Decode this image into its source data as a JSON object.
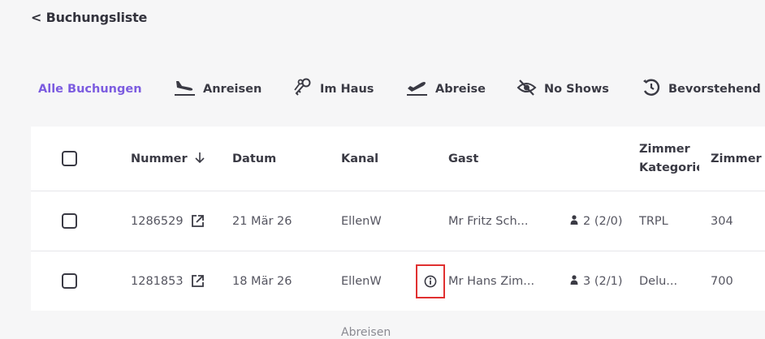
{
  "header": {
    "back_label": "< Buchungsliste"
  },
  "tabs": [
    {
      "label": "Alle Buchungen",
      "icon": "",
      "active": true
    },
    {
      "label": "Anreisen",
      "icon": "plane-landing-icon"
    },
    {
      "label": "Im Haus",
      "icon": "keys-icon"
    },
    {
      "label": "Abreise",
      "icon": "plane-departure-icon"
    },
    {
      "label": "No Shows",
      "icon": "eye-slash-icon"
    },
    {
      "label": "Bevorstehend",
      "icon": "clock-history-icon"
    }
  ],
  "table": {
    "columns": {
      "nummer": "Nummer",
      "datum": "Datum",
      "kanal": "Kanal",
      "gast": "Gast",
      "zimmer_kategorie": "Zimmer Kategorie",
      "zimmer": "Zimmer"
    },
    "rows": [
      {
        "nummer": "1286529",
        "datum": "21 Mär 26",
        "kanal": "EllenW",
        "gast": "Mr Fritz Sch...",
        "guests": "2 (2/0)",
        "zimmer_kategorie": "TRPL",
        "zimmer": "304",
        "info": false
      },
      {
        "nummer": "1281853",
        "datum": "18 Mär 26",
        "kanal": "EllenW",
        "gast": "Mr Hans Zim...",
        "guests": "3 (2/1)",
        "zimmer_kategorie": "Delu...",
        "zimmer": "700",
        "info": true
      }
    ]
  },
  "footer_peek": "Abreisen",
  "colors": {
    "accent": "#7c5ce0",
    "highlight": "#e03030",
    "background": "#f6f6f7"
  }
}
